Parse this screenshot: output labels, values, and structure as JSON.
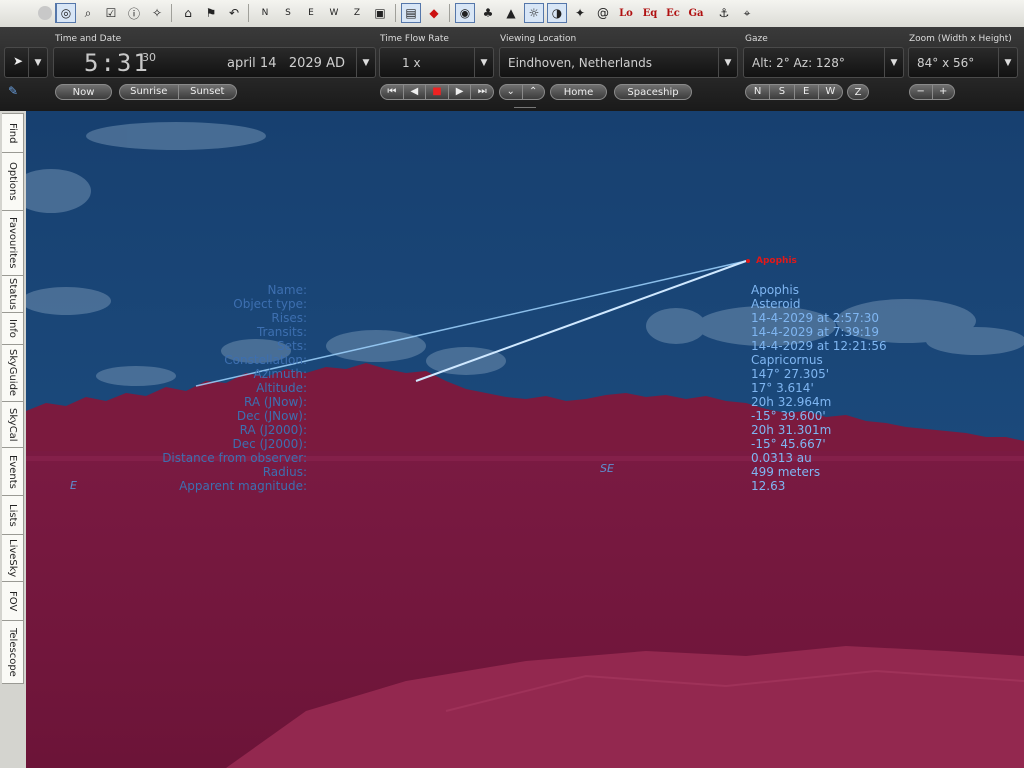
{
  "toolbar": {
    "icons": [
      "pointer-tool",
      "search",
      "checklist",
      "info",
      "telescope-control",
      "home",
      "flag",
      "undo",
      "north",
      "south",
      "east",
      "west",
      "zenith",
      "stop",
      "window",
      "diamond",
      "highlight",
      "tree",
      "stars",
      "compass",
      "night-mode",
      "constellations",
      "at",
      "local-grid",
      "equatorial-grid",
      "ecliptic-grid",
      "galactic-grid",
      "telescope",
      "satellite"
    ],
    "compass_letters": {
      "n": "N",
      "s": "S",
      "e": "E",
      "w": "W",
      "z": "Z"
    },
    "grid_labels": {
      "local": "Lo",
      "equatorial": "Eq",
      "ecliptic": "Ec",
      "galactic": "Ga"
    }
  },
  "time_date": {
    "caption": "Time and Date",
    "time": "5:31",
    "seconds": "30",
    "date": "april 14   2029 AD",
    "buttons": {
      "now": "Now",
      "sunrise": "Sunrise",
      "sunset": "Sunset"
    }
  },
  "time_flow": {
    "caption": "Time Flow Rate",
    "rate": "1 x"
  },
  "location": {
    "caption": "Viewing Location",
    "value": "Eindhoven, Netherlands",
    "buttons": {
      "home": "Home",
      "spaceship": "Spaceship"
    }
  },
  "gaze": {
    "caption": "Gaze",
    "value": "Alt: 2° Az: 128°",
    "buttons": {
      "n": "N",
      "s": "S",
      "e": "E",
      "w": "W",
      "z": "Z"
    }
  },
  "zoom": {
    "caption": "Zoom (Width x Height)",
    "value": "84° x 56°",
    "minus": "−",
    "plus": "+"
  },
  "sidebar_tabs": [
    "Find",
    "Options",
    "Favourites",
    "Status",
    "Info",
    "SkyGuide",
    "SkyCal",
    "Events",
    "Lists",
    "LiveSky",
    "FOV",
    "Telescope"
  ],
  "sky": {
    "object_label": "Apophis",
    "directions": {
      "east": "E",
      "southeast": "SE"
    },
    "colors": {
      "sky": "#1c4a7c",
      "land_tint": "#8a1c44",
      "track": "#9fd4ff",
      "label": "#e21818"
    }
  },
  "info_panel": {
    "rows": [
      {
        "label": "Name:",
        "value": "Apophis"
      },
      {
        "label": "Object type:",
        "value": "Asteroid"
      },
      {
        "label": "Rises:",
        "value": "14-4-2029 at 2:57:30"
      },
      {
        "label": "Transits:",
        "value": "14-4-2029 at 7:39:19"
      },
      {
        "label": "Sets:",
        "value": "14-4-2029 at 12:21:56"
      },
      {
        "label": "Constellation:",
        "value": "Capricornus"
      },
      {
        "label": "Azimuth:",
        "value": "147° 27.305'"
      },
      {
        "label": "Altitude:",
        "value": "17° 3.614'"
      },
      {
        "label": "RA (JNow):",
        "value": "20h 32.964m"
      },
      {
        "label": "Dec (JNow):",
        "value": "-15° 39.600'"
      },
      {
        "label": "RA (J2000):",
        "value": "20h 31.301m"
      },
      {
        "label": "Dec (J2000):",
        "value": "-15° 45.667'"
      },
      {
        "label": "Distance from observer:",
        "value": "0.0313 au"
      },
      {
        "label": "Radius:",
        "value": "499 meters"
      },
      {
        "label": "Apparent magnitude:",
        "value": "12.63"
      }
    ]
  }
}
